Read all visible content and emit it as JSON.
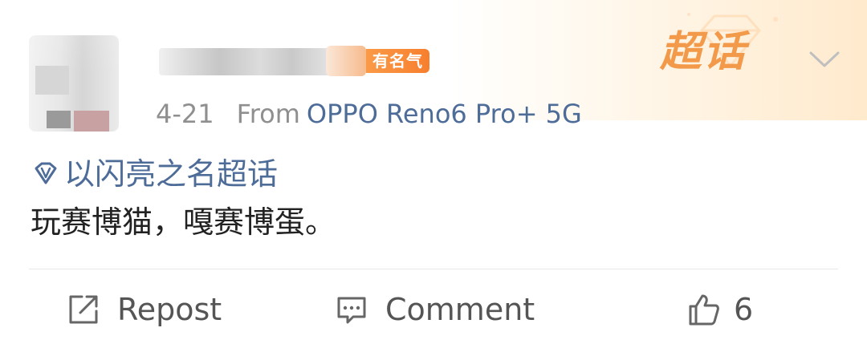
{
  "topic": {
    "label": "超话",
    "name": "以闪亮之名超话"
  },
  "post": {
    "badge": "有名气",
    "date": "4-21",
    "source_prefix": "From",
    "device": "OPPO Reno6 Pro+ 5G",
    "text": "玩赛博猫，嘎赛博蛋。"
  },
  "actions": {
    "repost": "Repost",
    "comment": "Comment",
    "like_count": "6"
  },
  "colors": {
    "link": "#4d6c98",
    "badge": "#f7892f",
    "topic_label": "#f39a4a",
    "text": "#222222",
    "secondary": "#8f8f8f"
  },
  "icons": [
    "diamond-icon",
    "chevron-down-icon",
    "repost-icon",
    "comment-icon",
    "like-icon"
  ]
}
